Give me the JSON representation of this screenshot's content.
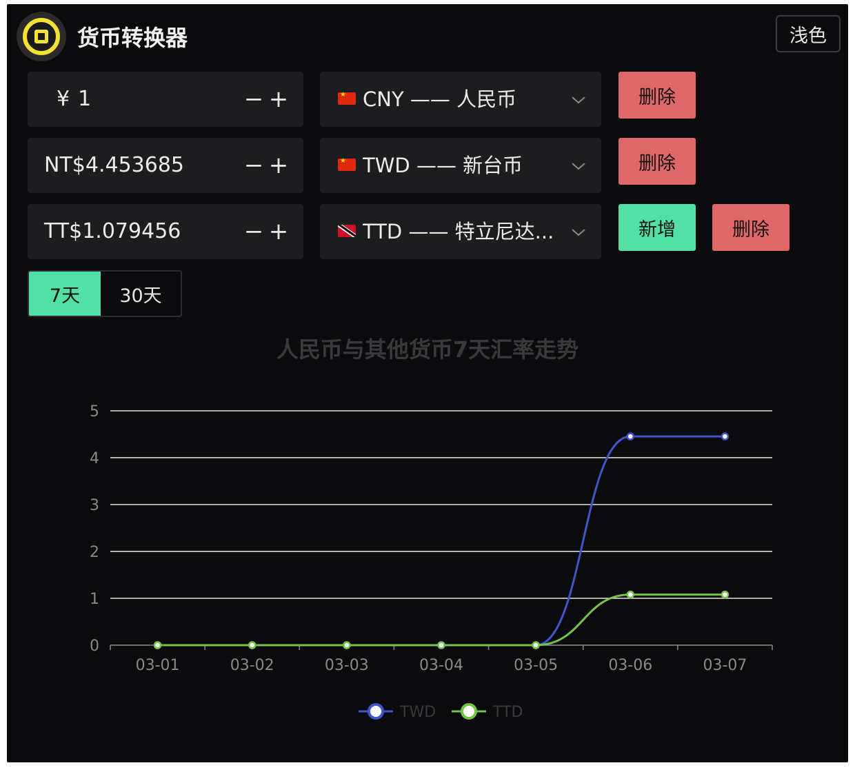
{
  "app": {
    "title": "货币转换器",
    "theme_button": "浅色"
  },
  "rows": [
    {
      "symbol": "¥",
      "amount": "1",
      "flag": "china-flag-icon",
      "currency": "CNY —— 人民币",
      "actions": [
        "删除"
      ]
    },
    {
      "symbol": "NT$",
      "amount": "4.453685",
      "flag": "china-flag-icon",
      "currency": "TWD —— 新台币",
      "actions": [
        "删除"
      ]
    },
    {
      "symbol": "TT$",
      "amount": "1.079456",
      "flag": "trinidad-flag-icon",
      "currency": "TTD —— 特立尼达...",
      "actions": [
        "新增",
        "删除"
      ]
    }
  ],
  "stepper": {
    "minus": "−",
    "plus": "+"
  },
  "range_tabs": {
    "active": "7天",
    "other": "30天"
  },
  "colors": {
    "accent_green": "#52e0a5",
    "delete_red": "#e06767",
    "twd_line": "#3f56c9",
    "ttd_line": "#74c449",
    "background": "#0b0b0d"
  },
  "chart_data": {
    "type": "line",
    "title": "人民币与其他货币7天汇率走势",
    "categories": [
      "03-01",
      "03-02",
      "03-03",
      "03-04",
      "03-05",
      "03-06",
      "03-07"
    ],
    "series": [
      {
        "name": "TWD",
        "values": [
          0,
          0,
          0,
          0,
          0,
          4.453685,
          4.453685
        ]
      },
      {
        "name": "TTD",
        "values": [
          0,
          0,
          0,
          0,
          0,
          1.079456,
          1.079456
        ]
      }
    ],
    "ylim": [
      0,
      5
    ],
    "yticks": [
      0,
      1,
      2,
      3,
      4,
      5
    ],
    "grid": true,
    "smooth": true,
    "legend": "bottom-center"
  }
}
